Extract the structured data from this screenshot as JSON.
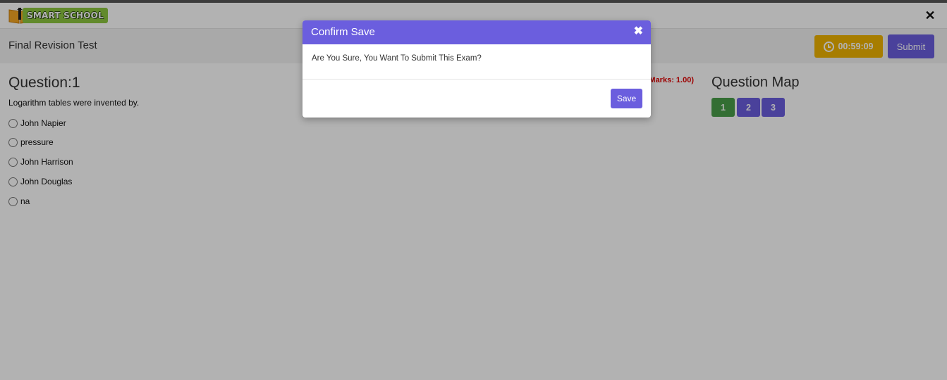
{
  "brand": {
    "name": "SMART SCHOOL",
    "logo_color": "#8dc63f"
  },
  "window": {
    "close_icon": "close-icon"
  },
  "exam": {
    "title": "Final Revision Test"
  },
  "timer": {
    "value": "00:59:09",
    "icon": "clock-icon",
    "color": "#f0b400"
  },
  "submit": {
    "label": "Submit"
  },
  "question": {
    "heading": "Question:1",
    "text": "Logarithm tables were invented by.",
    "marks": "Marks: 1.00)",
    "options": [
      "John Napier",
      "pressure",
      "John Harrison",
      "John Douglas",
      "na"
    ]
  },
  "question_map": {
    "heading": "Question Map",
    "items": [
      {
        "label": "1",
        "status": "answered",
        "color": "#4a9e4a"
      },
      {
        "label": "2",
        "status": "not-answered",
        "color": "#6b5ede"
      },
      {
        "label": "3",
        "status": "not-answered",
        "color": "#6b5ede"
      }
    ]
  },
  "modal": {
    "title": "Confirm Save",
    "message": "Are You Sure, You Want To Submit This Exam?",
    "save_label": "Save",
    "accent": "#6b5ede"
  }
}
